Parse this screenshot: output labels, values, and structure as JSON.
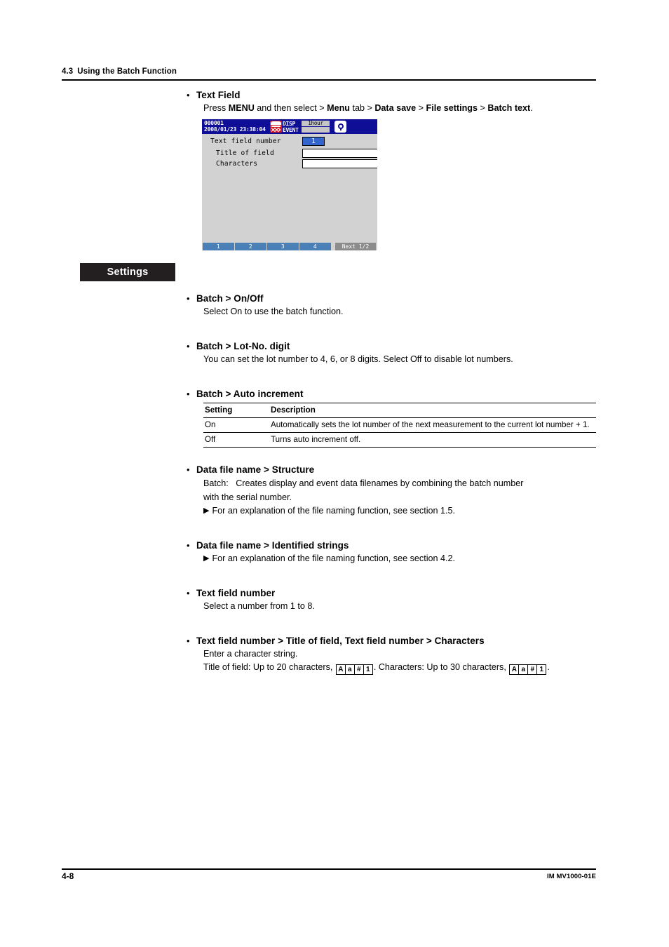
{
  "running_head": {
    "section_number": "4.3",
    "title": "Using the Batch Function"
  },
  "text_field_section": {
    "heading": "Text Field",
    "instruction_prefix": "Press ",
    "instruction_menu_key": "MENU",
    "instruction_mid": " and then select > ",
    "path_menu": "Menu",
    "path_tab_word": " tab > ",
    "path_data_save": "Data save",
    "sep1": " > ",
    "path_file_settings": "File settings",
    "sep2": " > ",
    "path_batch_text": "Batch text",
    "period": "."
  },
  "device_screen": {
    "batch_number": "000001",
    "datetime": "2008/01/23 23:38:04",
    "disp_label": "DISP",
    "event_label": "EVENT",
    "disp_value": "1hour",
    "event_value": "",
    "recorder_icon": "recorder-icon",
    "key_icon": "key-icon",
    "rows": [
      {
        "label": "Text field number",
        "value": "1",
        "type": "selected"
      },
      {
        "label": "Title of field",
        "value": "",
        "type": "input"
      },
      {
        "label": "Characters",
        "value": "",
        "type": "input"
      }
    ],
    "function_keys": [
      "1",
      "2",
      "3",
      "4"
    ],
    "next_key": "Next 1/2"
  },
  "settings_banner": {
    "label": "Settings"
  },
  "settings": {
    "batch_onoff": {
      "heading": "Batch > On/Off",
      "body": "Select On to use the batch function."
    },
    "batch_lotno": {
      "heading": "Batch > Lot-No. digit",
      "body": "You can set the lot number to 4, 6, or 8 digits. Select Off to disable lot numbers."
    },
    "batch_auto_increment": {
      "heading": "Batch > Auto increment",
      "table": {
        "headers": [
          "Setting",
          "Description"
        ],
        "rows": [
          [
            "On",
            "Automatically sets the lot number of the next measurement to the current lot number + 1."
          ],
          [
            "Off",
            "Turns auto increment off."
          ]
        ]
      }
    },
    "data_file_structure": {
      "heading": "Data file name > Structure",
      "body_line1": "Batch:   Creates display and event data filenames by combining the batch number",
      "body_line2": "with the serial number.",
      "note": "For an explanation of the file naming function, see section 1.5."
    },
    "data_file_identified": {
      "heading": "Data file name > Identified strings",
      "note": "For an explanation of the file naming function, see section 4.2."
    },
    "text_field_number": {
      "heading": "Text field number",
      "body": "Select a number from 1 to 8."
    },
    "text_field_title_chars": {
      "heading": "Text field number > Title of field,  Text field number > Characters",
      "body1": "Enter a character string.",
      "body2_part1": "Title of field: Up to 20 characters, ",
      "body2_part2": ". Characters: Up to 30 characters, ",
      "body2_part3": ".",
      "key_icon_glyphs": [
        "A",
        "a",
        "#",
        "1"
      ]
    }
  },
  "footer": {
    "page_number": "4-8",
    "document_id": "IM MV1000-01E"
  },
  "colors": {
    "banner_bg": "#231f20",
    "device_bg": "#d2d2d2",
    "device_header_bg": "#0e0e96",
    "selected_value_bg": "#3366cc",
    "fkey_bg": "#4a80b5",
    "next_key_bg": "#8c8c8c",
    "recorder_icon_red": "#d71920"
  }
}
